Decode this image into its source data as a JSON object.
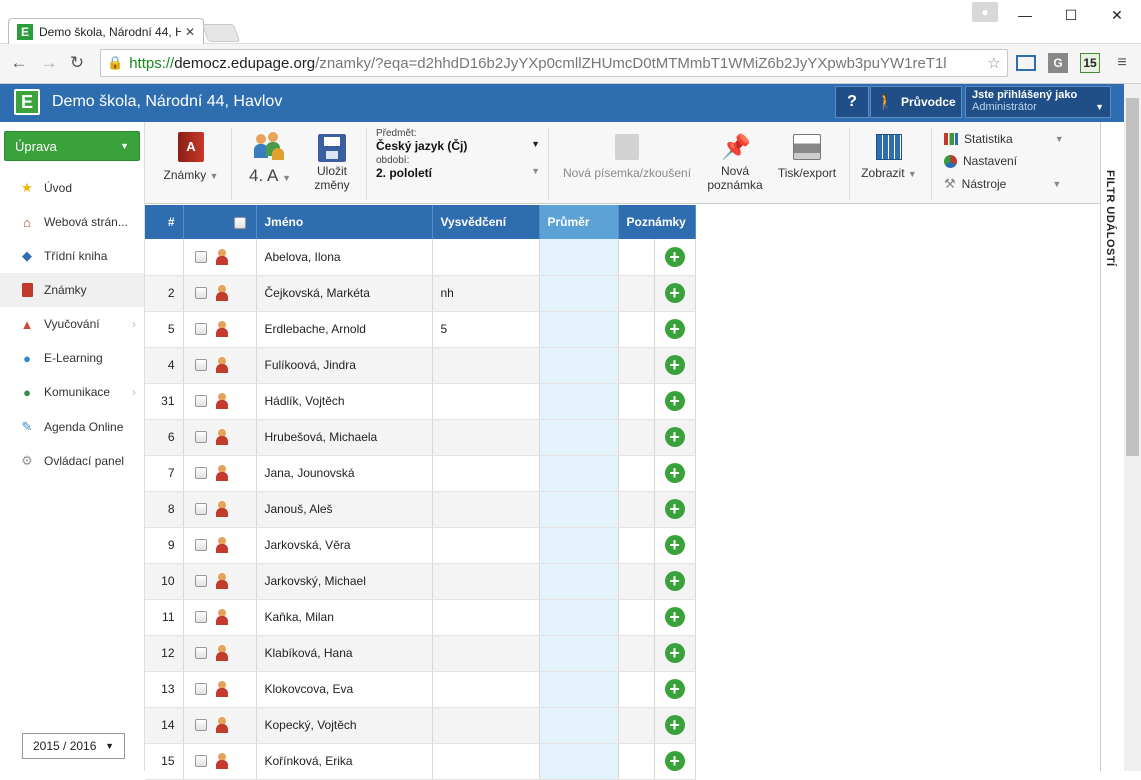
{
  "browser": {
    "tab_title": "Demo škola, Národní 44, H",
    "url_scheme": "https://",
    "url_host": "democz.edupage.org",
    "url_path": "/znamky/?eqa=d2hhdD16b2JyYXp0cmllZHUmcD0tMTMmbT1WMiZ6b2JyYXpwb3puYW1reT1l",
    "ext_badge": "15"
  },
  "app": {
    "school_name": "Demo škola, Národní 44, Havlov",
    "help_label": "?",
    "guide_label": "Průvodce",
    "login_title": "Jste přihlášený jako",
    "login_user": "Administrátor",
    "filter_panel": "FILTR UDÁLOSTÍ"
  },
  "sidebar": {
    "uprava": "Úprava",
    "items": [
      {
        "label": "Úvod",
        "icon": "star-icon"
      },
      {
        "label": "Webová strán...",
        "icon": "house-icon"
      },
      {
        "label": "Třídní kniha",
        "icon": "book-icon"
      },
      {
        "label": "Známky",
        "icon": "grades-icon"
      },
      {
        "label": "Vyučování",
        "icon": "teaching-icon"
      },
      {
        "label": "E-Learning",
        "icon": "globe-icon"
      },
      {
        "label": "Komunikace",
        "icon": "people-icon"
      },
      {
        "label": "Agenda Online",
        "icon": "pen-icon"
      },
      {
        "label": "Ovládací panel",
        "icon": "gear-icon"
      }
    ],
    "year": "2015 / 2016"
  },
  "toolbar": {
    "znamky": "Známky",
    "trida": "4. A",
    "ulozit_line1": "Uložit",
    "ulozit_line2": "změny",
    "predmet_caption": "Předmět:",
    "predmet_value": "Český jazyk (Čj)",
    "obdobi_caption": "období:",
    "obdobi_value": "2. pololetí",
    "nova_pisemka": "Nová písemka/zkoušení",
    "nova_poznamka_1": "Nová",
    "nova_poznamka_2": "poznámka",
    "tisk": "Tisk/export",
    "zobrazit": "Zobrazit",
    "statistika": "Statistika",
    "nastaveni": "Nastavení",
    "nastroje": "Nástroje"
  },
  "table": {
    "headers": {
      "num": "#",
      "jmeno": "Jméno",
      "vysvedceni": "Vysvědčení",
      "prumer": "Průměr",
      "poznamky": "Poznámky"
    },
    "rows": [
      {
        "num": "",
        "name": "Abelova, Ilona",
        "vysv": ""
      },
      {
        "num": "2",
        "name": "Čejkovská, Markéta",
        "vysv": "nh"
      },
      {
        "num": "5",
        "name": "Erdlebache, Arnold",
        "vysv": "5"
      },
      {
        "num": "4",
        "name": "Fulíkoová, Jindra",
        "vysv": ""
      },
      {
        "num": "31",
        "name": "Hádlík, Vojtěch",
        "vysv": ""
      },
      {
        "num": "6",
        "name": "Hrubešová, Michaela",
        "vysv": ""
      },
      {
        "num": "7",
        "name": "Jana, Jounovská",
        "vysv": ""
      },
      {
        "num": "8",
        "name": "Janouš, Aleš",
        "vysv": ""
      },
      {
        "num": "9",
        "name": "Jarkovská, Věra",
        "vysv": ""
      },
      {
        "num": "10",
        "name": "Jarkovský, Michael",
        "vysv": ""
      },
      {
        "num": "11",
        "name": "Kaňka, Milan",
        "vysv": ""
      },
      {
        "num": "12",
        "name": "Klabíková, Hana",
        "vysv": ""
      },
      {
        "num": "13",
        "name": "Klokovcova, Eva",
        "vysv": ""
      },
      {
        "num": "14",
        "name": "Kopecký, Vojtěch",
        "vysv": ""
      },
      {
        "num": "15",
        "name": "Kořínková, Erika",
        "vysv": ""
      }
    ]
  }
}
